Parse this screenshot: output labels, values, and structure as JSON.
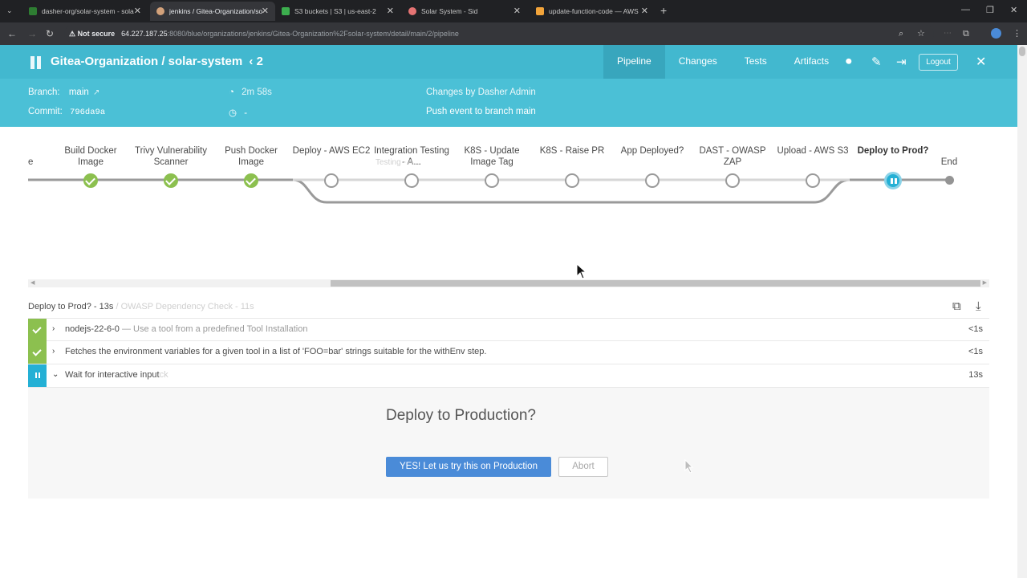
{
  "browser": {
    "tabs": [
      {
        "label": "dasher-org/solar-system - sola",
        "color": "#2e7d32"
      },
      {
        "label": "jenkins / Gitea-Organization/so",
        "color": "#d3a27b",
        "active": true
      },
      {
        "label": "S3 buckets | S3 | us-east-2",
        "color": "#3cae4e"
      },
      {
        "label": "Solar System - Sid",
        "color": "#e57373"
      },
      {
        "label": "update-function-code — AWS",
        "color": "#f2a43a"
      }
    ],
    "security_label": "Not secure",
    "url_host": "64.227.187.25",
    "url_path": ":8080/blue/organizations/jenkins/Gitea-Organization%2Fsolar-system/detail/main/2/pipeline"
  },
  "header": {
    "title": "Gitea-Organization / solar-system",
    "run_number": "2",
    "tabs": [
      "Pipeline",
      "Changes",
      "Tests",
      "Artifacts"
    ],
    "logout_label": "Logout"
  },
  "info": {
    "branch_label": "Branch:",
    "branch_value": "main",
    "commit_label": "Commit:",
    "commit_value": "796da9a",
    "duration": "2m 58s",
    "time_ago": "-",
    "changes": "Changes by Dasher Admin",
    "trigger": "Push event to branch main"
  },
  "pipeline": {
    "stages": [
      {
        "label": "e",
        "status": "none"
      },
      {
        "label": "Build Docker Image",
        "status": "success"
      },
      {
        "label": "Trivy Vulnerability Scanner",
        "status": "success"
      },
      {
        "label": "Push Docker Image",
        "status": "success"
      },
      {
        "label": "Deploy - AWS EC2",
        "status": "not-built"
      },
      {
        "label": "Integration Testing - A...",
        "status": "not-built"
      },
      {
        "label": "K8S - Update Image Tag",
        "status": "not-built"
      },
      {
        "label": "K8S - Raise PR",
        "status": "not-built"
      },
      {
        "label": "App Deployed?",
        "status": "not-built"
      },
      {
        "label": "DAST - OWASP ZAP",
        "status": "not-built"
      },
      {
        "label": "Upload - AWS S3",
        "status": "not-built"
      },
      {
        "label": "Deploy to Prod?",
        "status": "paused"
      },
      {
        "label": "End",
        "status": "end"
      }
    ],
    "ghost_text": "Testing - A..."
  },
  "steps": {
    "title": "Deploy to Prod? - 13s",
    "ghost_title": "/ OWASP Dependency Check - 11s",
    "rows": [
      {
        "name": "nodejs-22-6-0",
        "desc": "— Use a tool from a predefined Tool Installation",
        "duration": "<1s",
        "status": "success"
      },
      {
        "name": "Fetches the environment variables for a given tool in a list of 'FOO=bar' strings suitable for the withEnv step.",
        "desc": "",
        "duration": "<1s",
        "status": "success"
      },
      {
        "name": "Wait for interactive input",
        "desc": "",
        "ghost": "ck",
        "duration": "13s",
        "status": "paused"
      }
    ]
  },
  "input": {
    "question": "Deploy to Production?",
    "proceed_label": "YES! Let us try this on Production",
    "abort_label": "Abort"
  }
}
